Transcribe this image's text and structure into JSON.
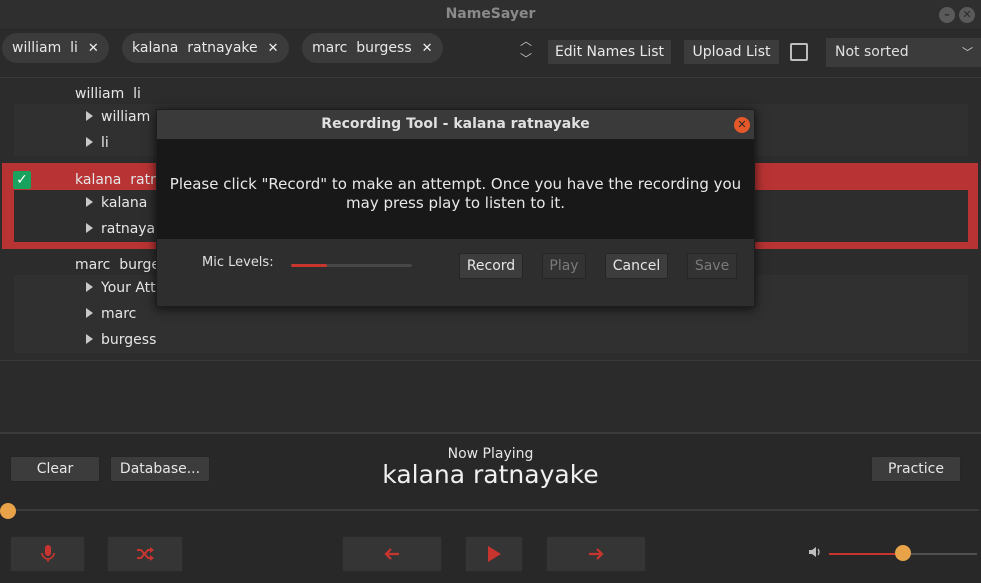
{
  "window": {
    "title": "NameSayer",
    "min_icon": "minimize-icon",
    "close_icon": "close-icon"
  },
  "toolbar": {
    "chips": [
      {
        "label": "william  li",
        "remove": "✕"
      },
      {
        "label": "kalana  ratnayake",
        "remove": "✕"
      },
      {
        "label": "marc  burgess",
        "remove": "✕"
      }
    ],
    "edit_names": "Edit Names List",
    "upload_list": "Upload List",
    "sort": {
      "selected": "Not sorted"
    }
  },
  "list": {
    "entries": [
      {
        "name": "william  li",
        "selected": false,
        "children": [
          "william",
          "li"
        ]
      },
      {
        "name": "kalana  ratnayake",
        "selected": true,
        "children": [
          "kalana",
          "ratnayake"
        ]
      },
      {
        "name": "marc  burgess",
        "selected": false,
        "children": [
          "Your Attempts",
          "marc",
          "burgess"
        ]
      }
    ]
  },
  "dialog": {
    "title": "Recording Tool - kalana ratnayake",
    "message_line1": "Please click \"Record\" to make an attempt. Once you have the recording you",
    "message_line2": "may press play to listen to it.",
    "mic_label": "Mic Levels:",
    "mic_level": 0.3,
    "record": "Record",
    "play": "Play",
    "cancel": "Cancel",
    "save": "Save"
  },
  "bottom": {
    "clear": "Clear",
    "database": "Database...",
    "now_playing_label": "Now Playing",
    "now_playing_name": "kalana ratnayake",
    "practice": "Practice",
    "seek_position": 0.0,
    "volume": 0.5
  },
  "colors": {
    "accent": "#c8352f",
    "selection": "#b83333",
    "knob": "#e8a349",
    "check": "#19a15e"
  }
}
